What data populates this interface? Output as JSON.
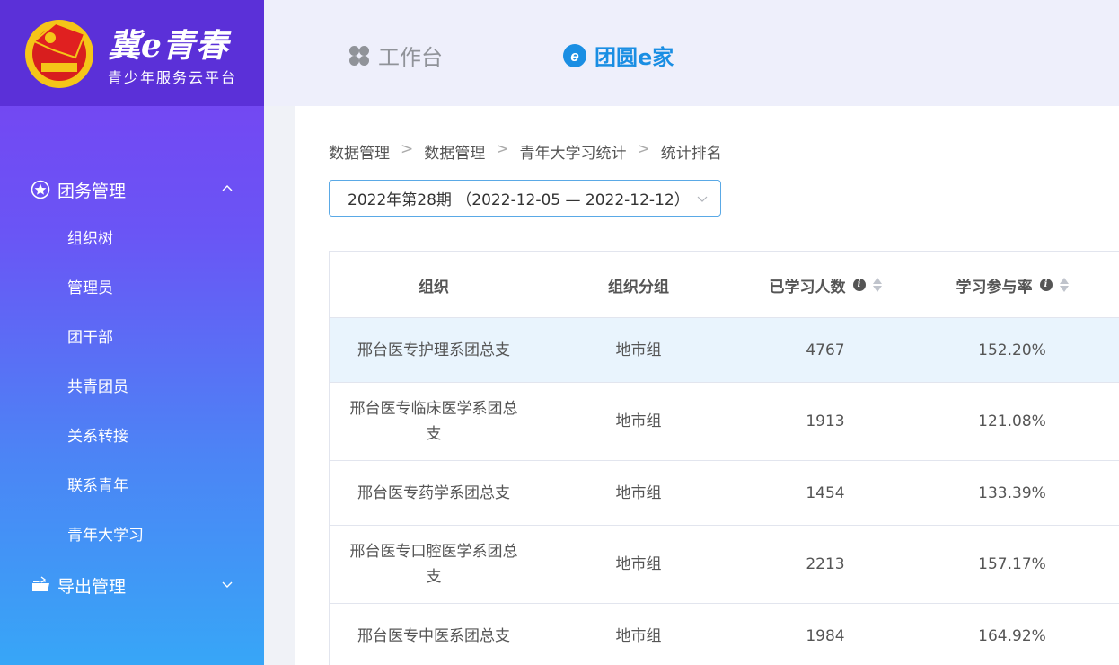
{
  "brand": {
    "title": "冀e青春",
    "subtitle": "青少年服务云平台"
  },
  "header": {
    "tabs": [
      {
        "label": "工作台",
        "icon": "grid-clover-icon"
      },
      {
        "label": "团圆e家",
        "icon": "e-circle-icon"
      }
    ]
  },
  "sidebar": {
    "groups": [
      {
        "label": "团务管理",
        "icon": "star-circle-icon",
        "expanded": true,
        "items": [
          "组织树",
          "管理员",
          "团干部",
          "共青团员",
          "关系转接",
          "联系青年",
          "青年大学习"
        ]
      },
      {
        "label": "导出管理",
        "icon": "folder-export-icon",
        "expanded": false
      }
    ]
  },
  "breadcrumb": [
    "数据管理",
    "数据管理",
    "青年大学习统计",
    "统计排名"
  ],
  "period_select": {
    "value": "2022年第28期 （2022-12-05 — 2022-12-12）"
  },
  "table": {
    "headers": [
      "组织",
      "组织分组",
      "已学习人数",
      "学习参与率"
    ],
    "rows": [
      {
        "org": "邢台医专护理系团总支",
        "group": "地市组",
        "count": "4767",
        "rate": "152.20%"
      },
      {
        "org": "邢台医专临床医学系团总支",
        "group": "地市组",
        "count": "1913",
        "rate": "121.08%"
      },
      {
        "org": "邢台医专药学系团总支",
        "group": "地市组",
        "count": "1454",
        "rate": "133.39%"
      },
      {
        "org": "邢台医专口腔医学系团总支",
        "group": "地市组",
        "count": "2213",
        "rate": "157.17%"
      },
      {
        "org": "邢台医专中医系团总支",
        "group": "地市组",
        "count": "1984",
        "rate": "164.92%"
      }
    ]
  },
  "colors": {
    "accent": "#1a8ee3",
    "sidebar_top": "#7a3df0",
    "sidebar_bottom": "#37a6f7",
    "row_highlight": "#e9f4fd"
  }
}
